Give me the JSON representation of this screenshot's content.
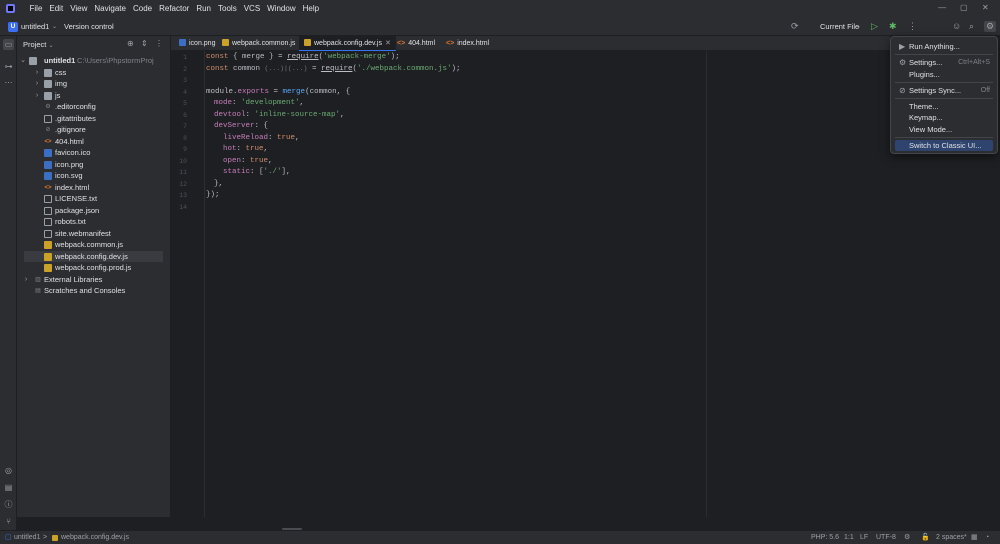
{
  "menu": [
    "File",
    "Edit",
    "View",
    "Navigate",
    "Code",
    "Refactor",
    "Run",
    "Tools",
    "VCS",
    "Window",
    "Help"
  ],
  "project": {
    "badge": "U",
    "name": "untitled1",
    "vcs": "Version control"
  },
  "run_config": "Current File",
  "panel": {
    "title": "Project"
  },
  "tree": {
    "root": "untitled1",
    "root_path": "C:\\Users\\PhpstormProj",
    "items": [
      "css",
      "img",
      "js",
      ".editorconfig",
      ".gitattributes",
      ".gitignore",
      "404.html",
      "favicon.ico",
      "icon.png",
      "icon.svg",
      "index.html",
      "LICENSE.txt",
      "package.json",
      "robots.txt",
      "site.webmanifest",
      "webpack.common.js",
      "webpack.config.dev.js",
      "webpack.config.prod.js"
    ],
    "external": "External Libraries",
    "scratches": "Scratches and Consoles"
  },
  "tabs": [
    "icon.png",
    "webpack.common.js",
    "webpack.config.dev.js",
    "404.html",
    "index.html"
  ],
  "code": {
    "line_numbers": [
      "1",
      "2",
      "3",
      "4",
      "5",
      "6",
      "7",
      "8",
      "9",
      "10",
      "11",
      "12",
      "13",
      "14"
    ],
    "l1": {
      "kw": "const",
      "open": " { ",
      "id": "merge",
      "close": " } = ",
      "req": "require",
      "p1": "(",
      "s": "'webpack-merge'",
      "p2": ");"
    },
    "l2": {
      "kw": "const",
      "id": " common ",
      "hint": "(...)|(...)",
      "eq": " = ",
      "req": "require",
      "p1": "(",
      "s": "'./webpack.common.js'",
      "p2": ");"
    },
    "l4": {
      "a": "module.",
      "b": "exports",
      "c": " = ",
      "d": "merge",
      "e": "(common, {"
    },
    "l5": {
      "k": "mode",
      "c": ": ",
      "v": "'development'",
      "e": ","
    },
    "l6": {
      "k": "devtool",
      "c": ": ",
      "v": "'inline-source-map'",
      "e": ","
    },
    "l7": {
      "k": "devServer",
      "e": ": {"
    },
    "l8": {
      "k": "liveReload",
      "c": ": ",
      "v": "true",
      "e": ","
    },
    "l9": {
      "k": "hot",
      "c": ": ",
      "v": "true",
      "e": ","
    },
    "l10": {
      "k": "open",
      "c": ": ",
      "v": "true",
      "e": ","
    },
    "l11": {
      "k": "static",
      "c": ": [",
      "v": "'./'",
      "e": "],"
    },
    "l12": "},",
    "l13": "});"
  },
  "dropdown": {
    "run_anything": "Run Anything...",
    "settings": "Settings...",
    "settings_sc": "Ctrl+Alt+S",
    "plugins": "Plugins...",
    "sync": "Settings Sync...",
    "sync_state": "Off",
    "theme": "Theme...",
    "keymap": "Keymap...",
    "view_mode": "View Mode...",
    "classic": "Switch to Classic UI..."
  },
  "status": {
    "breadcrumb_root": "untitled1",
    "breadcrumb_sep": ">",
    "breadcrumb_file": "webpack.config.dev.js",
    "php": "PHP: 5.6",
    "pos": "1:1",
    "le": "LF",
    "enc": "UTF-8",
    "indent": "2 spaces*"
  }
}
